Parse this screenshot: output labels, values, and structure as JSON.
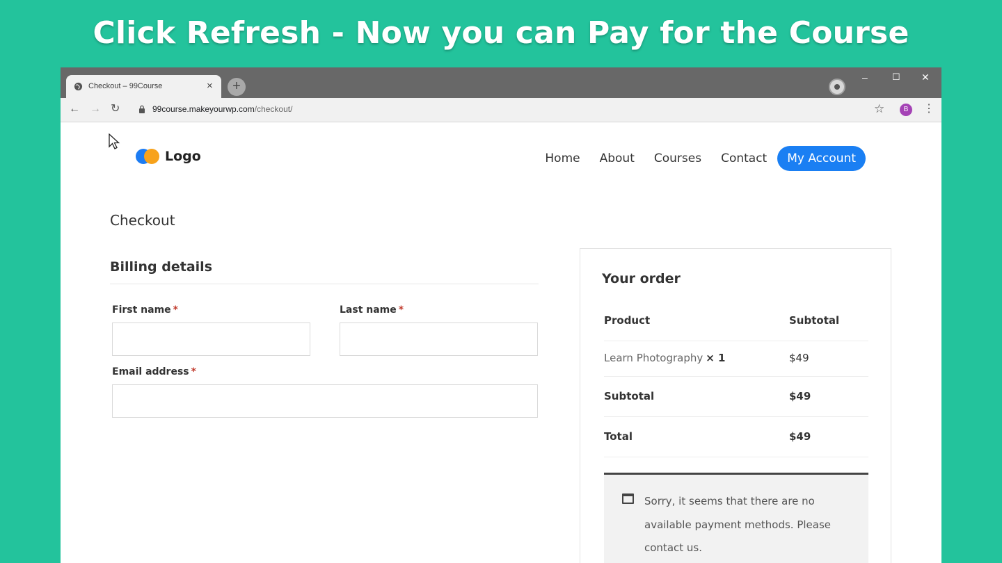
{
  "banner": {
    "text": "Click Refresh - Now you can Pay for the Course"
  },
  "browser": {
    "tab_title": "Checkout – 99Course",
    "tab_close": "×",
    "new_tab": "+",
    "window_controls": {
      "minimize": "–",
      "maximize": "☐",
      "close": "✕"
    },
    "nav": {
      "back": "←",
      "forward": "→",
      "reload": "↻"
    },
    "url_host": "99course.makeyourwp.com",
    "url_path": "/checkout/",
    "bookmark": "☆",
    "profile_initial": "B",
    "menu": "⋮"
  },
  "site": {
    "logo_text": "Logo",
    "nav": [
      {
        "label": "Home"
      },
      {
        "label": "About"
      },
      {
        "label": "Courses"
      },
      {
        "label": "Contact"
      }
    ],
    "account_button": "My Account"
  },
  "checkout": {
    "page_title": "Checkout",
    "billing_title": "Billing details",
    "required_mark": "*",
    "fields": {
      "first_name": {
        "label": "First name",
        "value": ""
      },
      "last_name": {
        "label": "Last name",
        "value": ""
      },
      "email": {
        "label": "Email address",
        "value": ""
      }
    }
  },
  "order": {
    "title": "Your order",
    "headers": {
      "product": "Product",
      "subtotal": "Subtotal"
    },
    "items": [
      {
        "name": "Learn Photography",
        "qty": "× 1",
        "price": "$49"
      }
    ],
    "subtotal": {
      "label": "Subtotal",
      "value": "$49"
    },
    "total": {
      "label": "Total",
      "value": "$49"
    },
    "payment_message": "Sorry, it seems that there are no available payment methods. Please contact us."
  },
  "colors": {
    "background": "#23c39c",
    "accent": "#1a7ff3",
    "logo_blue": "#1c7cf3",
    "logo_orange": "#f7a21b",
    "profile": "#a442b5",
    "required": "#c0392b"
  }
}
